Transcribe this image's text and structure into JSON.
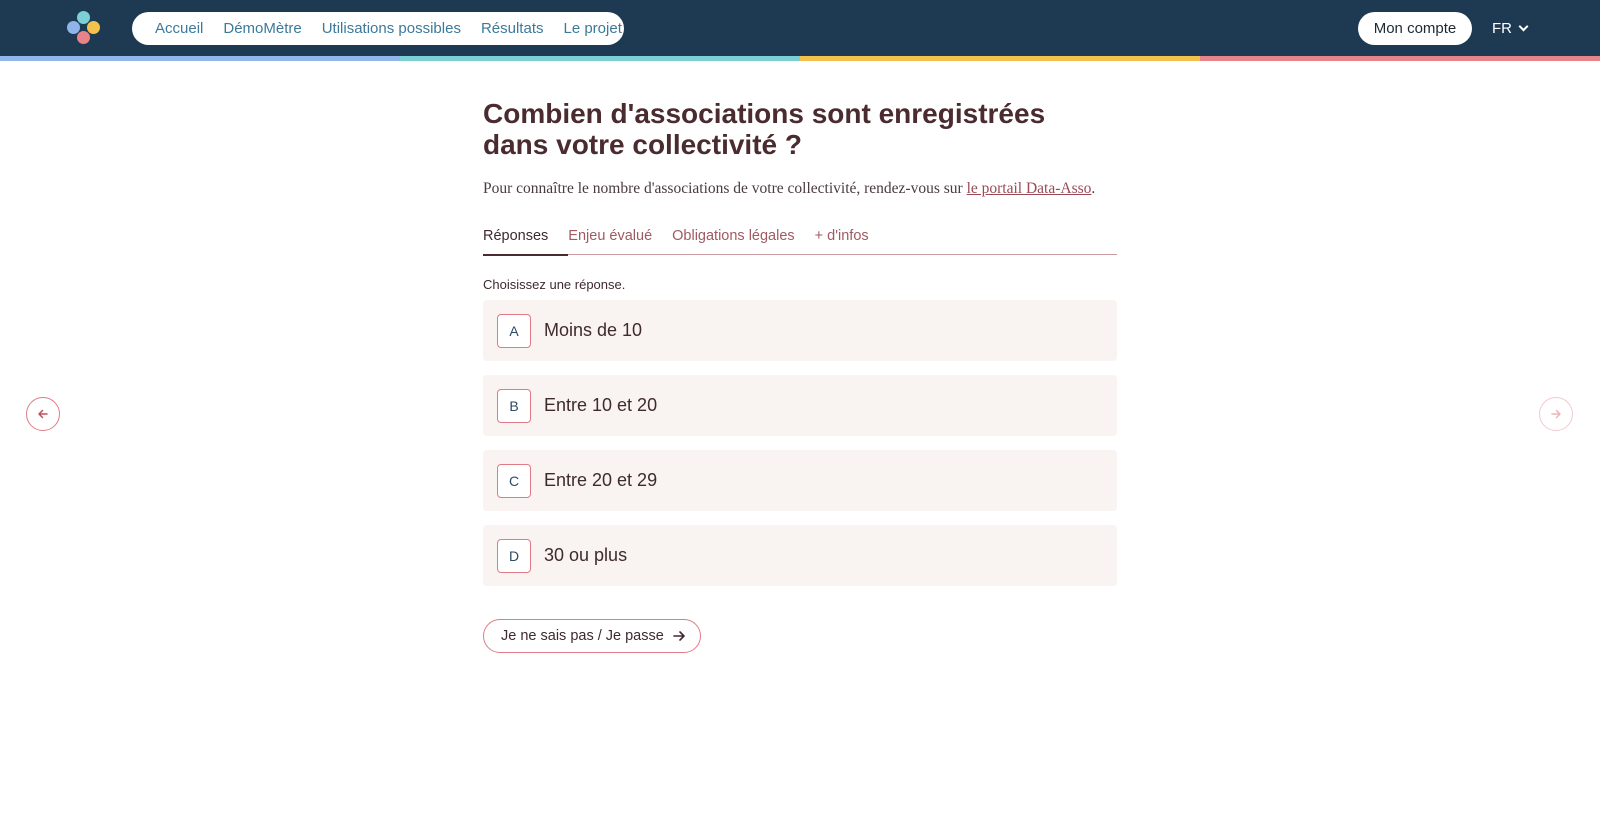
{
  "header": {
    "nav": [
      "Accueil",
      "DémoMètre",
      "Utilisations possibles",
      "Résultats",
      "Le projet"
    ],
    "account_label": "Mon compte",
    "language": "FR"
  },
  "stripe_colors": [
    "#8fb5ea",
    "#7ccfd4",
    "#f2c14e",
    "#e8838a"
  ],
  "question": {
    "title": "Combien d'associations sont enregistrées dans votre collectivité ?",
    "intro_text": "Pour connaître le nombre d'associations de votre collectivité, rendez-vous sur ",
    "intro_link": "le portail Data-Asso",
    "intro_end": "."
  },
  "tabs": [
    "Réponses",
    "Enjeu évalué",
    "Obligations légales",
    "+ d'infos"
  ],
  "active_tab": "Réponses",
  "prompt": "Choisissez une réponse.",
  "options": [
    {
      "letter": "A",
      "label": "Moins de 10"
    },
    {
      "letter": "B",
      "label": "Entre 10 et 20"
    },
    {
      "letter": "C",
      "label": "Entre 20 et 29"
    },
    {
      "letter": "D",
      "label": "30 ou plus"
    }
  ],
  "skip_label": "Je ne sais pas / Je passe",
  "icons": {
    "prev": "arrow-left-icon",
    "next": "arrow-right-icon",
    "skip": "arrow-right-icon",
    "lang": "chevron-down-icon"
  }
}
